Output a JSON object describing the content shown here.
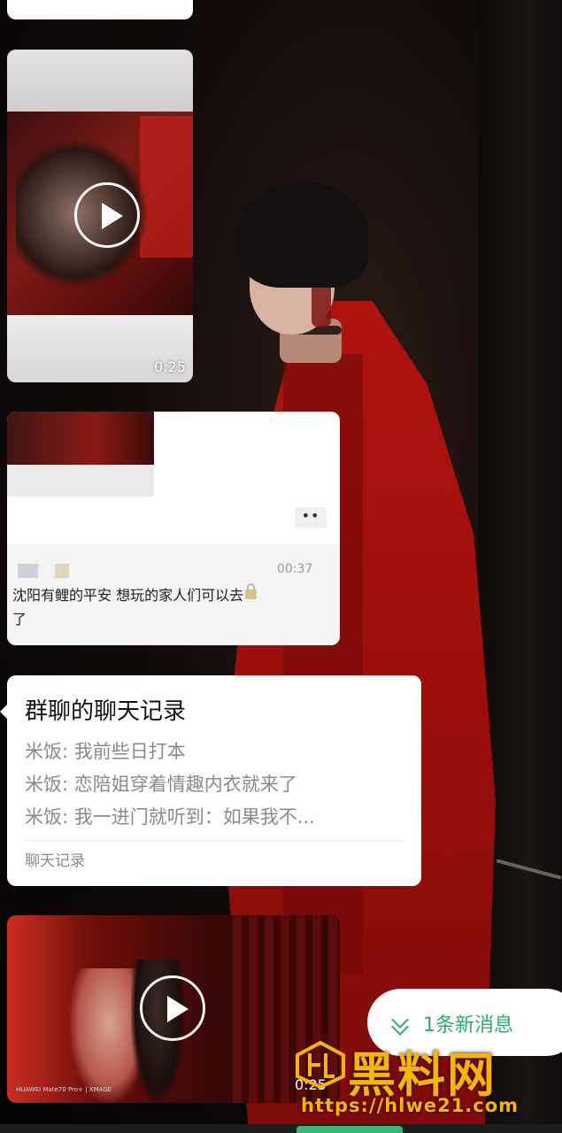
{
  "video_message_1": {
    "duration": "0:25"
  },
  "forwarded_message": {
    "more_icon": "••",
    "time": "00:37",
    "text": "沈阳有鲤的平安 想玩的家人们可以去",
    "text_tail": "了"
  },
  "chat_record": {
    "title": "群聊的聊天记录",
    "lines": [
      "米饭: 我前些日打本",
      "米饭: 恋陪姐穿着情趣内衣就来了",
      "米饭: 我一进门就听到：如果我不..."
    ],
    "footer": "聊天记录"
  },
  "video_message_2": {
    "duration": "0:25",
    "camera_watermark": "HUAWEI Mate70 Pro+ | XMAGE"
  },
  "new_message_button": {
    "label": "1条新消息",
    "color": "#2aae67"
  },
  "site_watermark": {
    "name": "黑料网",
    "url": "https://hlwe21.com",
    "color": "#f7b500"
  }
}
